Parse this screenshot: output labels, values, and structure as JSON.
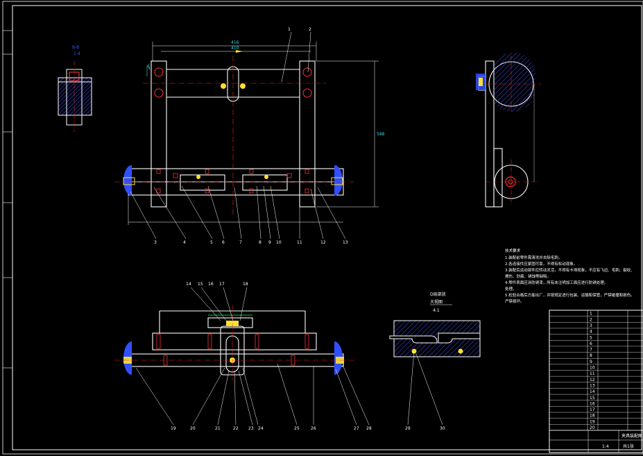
{
  "view_labels": {
    "section_b": "B-B",
    "section_b_scale": "1:4",
    "detail_title_1": "D局部放",
    "detail_title_2": "大视图",
    "detail_scale": "4:1"
  },
  "dims": {
    "d1": "416",
    "d2": "410",
    "d3": "588"
  },
  "callouts_top": [
    "1",
    "2",
    "3",
    "4",
    "5",
    "6",
    "7",
    "8",
    "9",
    "10",
    "11",
    "12",
    "13"
  ],
  "callouts_bottom_top": [
    "14",
    "15",
    "16",
    "17",
    "18"
  ],
  "callouts_bottom": [
    "19",
    "20",
    "21",
    "22",
    "23",
    "24",
    "25",
    "26",
    "27",
    "28"
  ],
  "callouts_detail": [
    "29",
    "30"
  ],
  "notes": {
    "title": "技术要求",
    "lines": [
      "1.装配前零件需清洗并去除毛刺。",
      "2.各连接件应紧固可靠，不得有松动现象。",
      "3.装配后运动部件应转动灵活，不得有卡滞现象，不应有飞边、毛刺、裂纹、",
      "擦伤、划痕、锈蚀等缺陷。",
      "4.零件表面应涂防锈漆，所有未注明加工面应进行防锈处理。",
      "处理。",
      "5.检验合格后方能出厂，并按规定进行包装、运输和保管，严禁碰撞和损伤。",
      "严禁损坏。"
    ]
  },
  "title_block": {
    "rows": [
      "1",
      "2",
      "3",
      "4",
      "5",
      "6",
      "7",
      "8",
      "9",
      "10",
      "11",
      "12",
      "13",
      "14",
      "15",
      "16",
      "17",
      "18",
      "19",
      "20"
    ],
    "drawing_name": "夹具装配图",
    "scale": "1:4",
    "sheet": "共1张"
  },
  "colors": {
    "line_white": "#ffffff",
    "dim_cyan": "#35d6e6",
    "center_red": "#ff2020",
    "part_blue": "#3050ff",
    "part_yellow": "#ffe030",
    "hatch_blue": "#3a48d8",
    "leader_cyan": "#40e0f0",
    "dim_green": "#20ff40"
  }
}
